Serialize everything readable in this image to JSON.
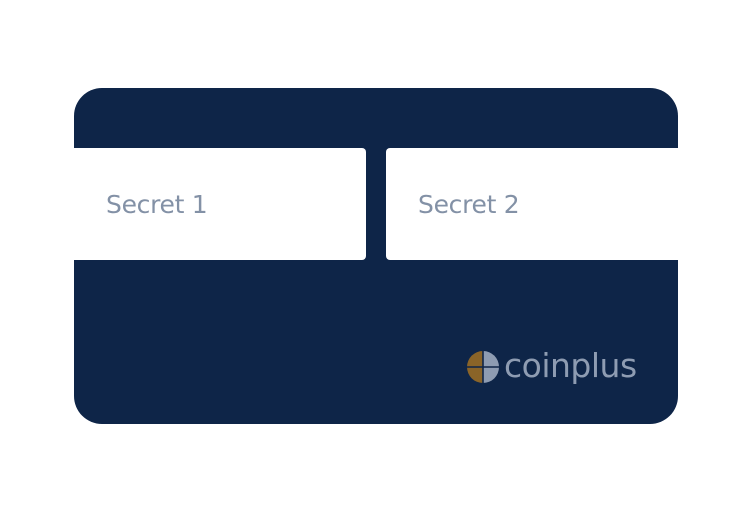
{
  "card": {
    "slots": [
      {
        "label": "Secret 1"
      },
      {
        "label": "Secret 2"
      }
    ],
    "brand": {
      "name": "coinplus",
      "icon": "coinplus-logo-icon"
    }
  },
  "colors": {
    "card_background": "#0e2548",
    "slot_background": "#ffffff",
    "slot_text": "#8391a6",
    "brand_text": "#8e9cb2",
    "logo_gold": "#8a6428",
    "logo_blue": "#8e9cb2"
  }
}
